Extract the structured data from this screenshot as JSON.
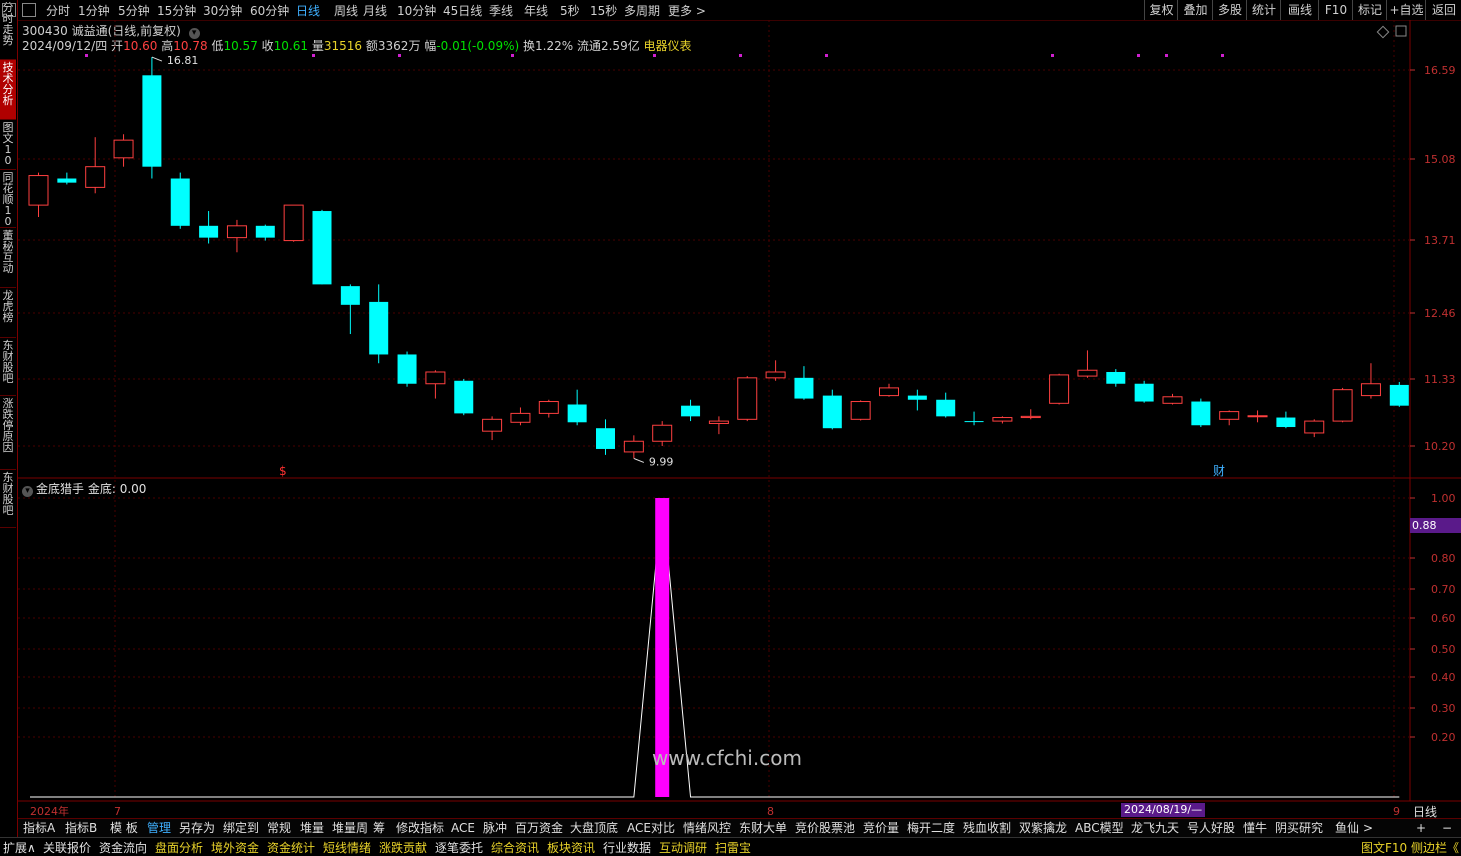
{
  "top_bar": {
    "timeframes": [
      "分时",
      "1分钟",
      "5分钟",
      "15分钟",
      "30分钟",
      "60分钟",
      "日线",
      "周线",
      "月线",
      "10分钟",
      "45日线",
      "季线",
      "年线",
      "5秒",
      "15秒",
      "多周期",
      "更多 >"
    ],
    "selected": "日线",
    "right_buttons": [
      "复权",
      "叠加",
      "多股",
      "统计",
      "画线",
      "F10",
      "标记",
      "+自选",
      "返回"
    ]
  },
  "left_tabs": [
    "分时走势",
    "技术分析",
    "图文10",
    "同花顺10",
    "董秘互动",
    "龙虎榜",
    "东财股吧",
    "涨跌停原因",
    "东财股吧"
  ],
  "left_tab_selected": "技术分析",
  "stock": {
    "title": "300430 诚益通(日线,前复权)",
    "date": "2024/09/12/四",
    "open_label": "开",
    "open": "10.60",
    "high_label": "高",
    "high": "10.78",
    "low_label": "低",
    "low": "10.57",
    "close_label": "收",
    "close": "10.61",
    "volume_label": "量",
    "volume": "31516",
    "amount_label": "额",
    "amount": "3362万",
    "change_label": "幅",
    "change": "-0.01(-0.09%)",
    "turnover_label": "换",
    "turnover": "1.22%",
    "float_label": "流通",
    "float_cap": "2.59亿",
    "industry": "电器仪表"
  },
  "price_axis": [
    "16.59",
    "15.08",
    "13.71",
    "12.46",
    "11.33",
    "10.20"
  ],
  "indicator": {
    "name": "金底猎手",
    "value_text": "金底: 0.00",
    "axis": [
      "1.00",
      "0.80",
      "0.70",
      "0.60",
      "0.50",
      "0.40",
      "0.30",
      "0.20"
    ],
    "current_badge": "0.88"
  },
  "chart_data": {
    "type": "candlestick",
    "price_ylim_labels": [
      "16.59",
      "15.08",
      "13.71",
      "12.46",
      "11.33",
      "10.20"
    ],
    "max_marker": "16.81",
    "min_marker": "9.99",
    "candles": [
      {
        "o": 14.3,
        "c": 14.8,
        "h": 14.85,
        "l": 14.1
      },
      {
        "o": 14.75,
        "c": 14.68,
        "h": 14.85,
        "l": 14.65
      },
      {
        "o": 14.6,
        "c": 14.95,
        "h": 15.45,
        "l": 14.5
      },
      {
        "o": 15.1,
        "c": 15.4,
        "h": 15.5,
        "l": 14.95
      },
      {
        "o": 16.5,
        "c": 14.95,
        "h": 16.81,
        "l": 14.75
      },
      {
        "o": 14.75,
        "c": 13.95,
        "h": 14.85,
        "l": 13.9
      },
      {
        "o": 13.95,
        "c": 13.75,
        "h": 14.2,
        "l": 13.65
      },
      {
        "o": 13.75,
        "c": 13.95,
        "h": 14.05,
        "l": 13.5
      },
      {
        "o": 13.95,
        "c": 13.75,
        "h": 13.97,
        "l": 13.7
      },
      {
        "o": 13.7,
        "c": 14.3,
        "h": 14.3,
        "l": 13.68
      },
      {
        "o": 14.2,
        "c": 12.95,
        "h": 14.22,
        "l": 12.95
      },
      {
        "o": 12.92,
        "c": 12.6,
        "h": 12.95,
        "l": 12.1
      },
      {
        "o": 12.65,
        "c": 11.75,
        "h": 12.95,
        "l": 11.6
      },
      {
        "o": 11.75,
        "c": 11.25,
        "h": 11.8,
        "l": 11.2
      },
      {
        "o": 11.25,
        "c": 11.45,
        "h": 11.48,
        "l": 11.0
      },
      {
        "o": 11.3,
        "c": 10.75,
        "h": 11.33,
        "l": 10.72
      },
      {
        "o": 10.45,
        "c": 10.65,
        "h": 10.7,
        "l": 10.3
      },
      {
        "o": 10.6,
        "c": 10.75,
        "h": 10.85,
        "l": 10.55
      },
      {
        "o": 10.75,
        "c": 10.95,
        "h": 10.98,
        "l": 10.68
      },
      {
        "o": 10.9,
        "c": 10.6,
        "h": 11.15,
        "l": 10.55
      },
      {
        "o": 10.5,
        "c": 10.15,
        "h": 10.65,
        "l": 10.05
      },
      {
        "o": 10.1,
        "c": 10.28,
        "h": 10.38,
        "l": 9.99
      },
      {
        "o": 10.28,
        "c": 10.55,
        "h": 10.62,
        "l": 10.2
      },
      {
        "o": 10.88,
        "c": 10.7,
        "h": 10.98,
        "l": 10.62
      },
      {
        "o": 10.58,
        "c": 10.62,
        "h": 10.7,
        "l": 10.4
      },
      {
        "o": 10.65,
        "c": 11.35,
        "h": 11.38,
        "l": 10.62
      },
      {
        "o": 11.35,
        "c": 11.45,
        "h": 11.65,
        "l": 11.3
      },
      {
        "o": 11.35,
        "c": 11.0,
        "h": 11.55,
        "l": 10.98
      },
      {
        "o": 11.05,
        "c": 10.5,
        "h": 11.15,
        "l": 10.48
      },
      {
        "o": 10.65,
        "c": 10.95,
        "h": 10.97,
        "l": 10.63
      },
      {
        "o": 11.05,
        "c": 11.18,
        "h": 11.25,
        "l": 11.03
      },
      {
        "o": 11.05,
        "c": 10.98,
        "h": 11.15,
        "l": 10.8
      },
      {
        "o": 10.98,
        "c": 10.7,
        "h": 11.1,
        "l": 10.68
      },
      {
        "o": 10.62,
        "c": 10.61,
        "h": 10.78,
        "l": 10.55
      },
      {
        "o": 10.62,
        "c": 10.68,
        "h": 10.7,
        "l": 10.58
      },
      {
        "o": 10.68,
        "c": 10.7,
        "h": 10.82,
        "l": 10.65
      },
      {
        "o": 10.92,
        "c": 11.4,
        "h": 11.42,
        "l": 10.9
      },
      {
        "o": 11.38,
        "c": 11.48,
        "h": 11.82,
        "l": 11.35
      },
      {
        "o": 11.45,
        "c": 11.25,
        "h": 11.5,
        "l": 11.2
      },
      {
        "o": 11.25,
        "c": 10.95,
        "h": 11.3,
        "l": 10.93
      },
      {
        "o": 10.92,
        "c": 11.03,
        "h": 11.08,
        "l": 10.9
      },
      {
        "o": 10.95,
        "c": 10.55,
        "h": 11.0,
        "l": 10.52
      },
      {
        "o": 10.65,
        "c": 10.78,
        "h": 10.8,
        "l": 10.55
      },
      {
        "o": 10.7,
        "c": 10.71,
        "h": 10.8,
        "l": 10.6
      },
      {
        "o": 10.68,
        "c": 10.52,
        "h": 10.78,
        "l": 10.5
      },
      {
        "o": 10.42,
        "c": 10.62,
        "h": 10.65,
        "l": 10.35
      },
      {
        "o": 10.62,
        "c": 11.15,
        "h": 11.18,
        "l": 10.6
      },
      {
        "o": 11.05,
        "c": 11.25,
        "h": 11.6,
        "l": 11.0
      },
      {
        "o": 11.23,
        "c": 10.88,
        "h": 11.28,
        "l": 10.86
      }
    ],
    "indicator_series": [
      0,
      0,
      0,
      0,
      0,
      0,
      0,
      0,
      0,
      0,
      0,
      0,
      0,
      0,
      0,
      0,
      0,
      0,
      0,
      0,
      0,
      0.0,
      1.0,
      0,
      0,
      0,
      0,
      0,
      0,
      0,
      0,
      0,
      0,
      0,
      0,
      0,
      0,
      0,
      0,
      0,
      0,
      0,
      0,
      0,
      0,
      0,
      0,
      0,
      0
    ],
    "indicator_ylim": [
      0,
      1
    ],
    "x_labels": [
      "2024年",
      "7",
      "8",
      "2024/08/19/—",
      "9"
    ],
    "event_markers": [
      "$",
      "财"
    ]
  },
  "bottom_tabs": [
    "指标A",
    "指标B",
    "模 板",
    "管理",
    "另存为",
    "绑定到",
    "常规",
    "堆量",
    "堆量周",
    "筹",
    "修改指标",
    "ACE",
    "脉冲",
    "百万资金",
    "大盘顶底",
    "ACE对比",
    "情绪风控",
    "东财大单",
    "竞价股票池",
    "竞价量",
    "梅开二度",
    "残血收割",
    "双紫擒龙",
    "ABC模型",
    "龙飞九天",
    "号人好股",
    "懂牛",
    "阴买研究",
    "鱼仙"
  ],
  "bottom_tab_selected": "管理",
  "bottom_right": [
    "+",
    "−"
  ],
  "period_label": "日线",
  "status_tabs": [
    "扩展∧",
    "关联报价",
    "资金流向",
    "盘面分析",
    "境外资金",
    "资金统计",
    "短线情绪",
    "涨跌贡献",
    "逐笔委托",
    "综合资讯",
    "板块资讯",
    "行业数据",
    "互动调研",
    "扫雷宝"
  ],
  "status_right": "图文F10 侧边栏《",
  "watermark": "www.cfchi.com",
  "colors": {
    "up": "#ff4040",
    "down": "#00ffff",
    "indicator": "#ff00ff",
    "grid": "#5a0000",
    "axis": "#c03030"
  }
}
